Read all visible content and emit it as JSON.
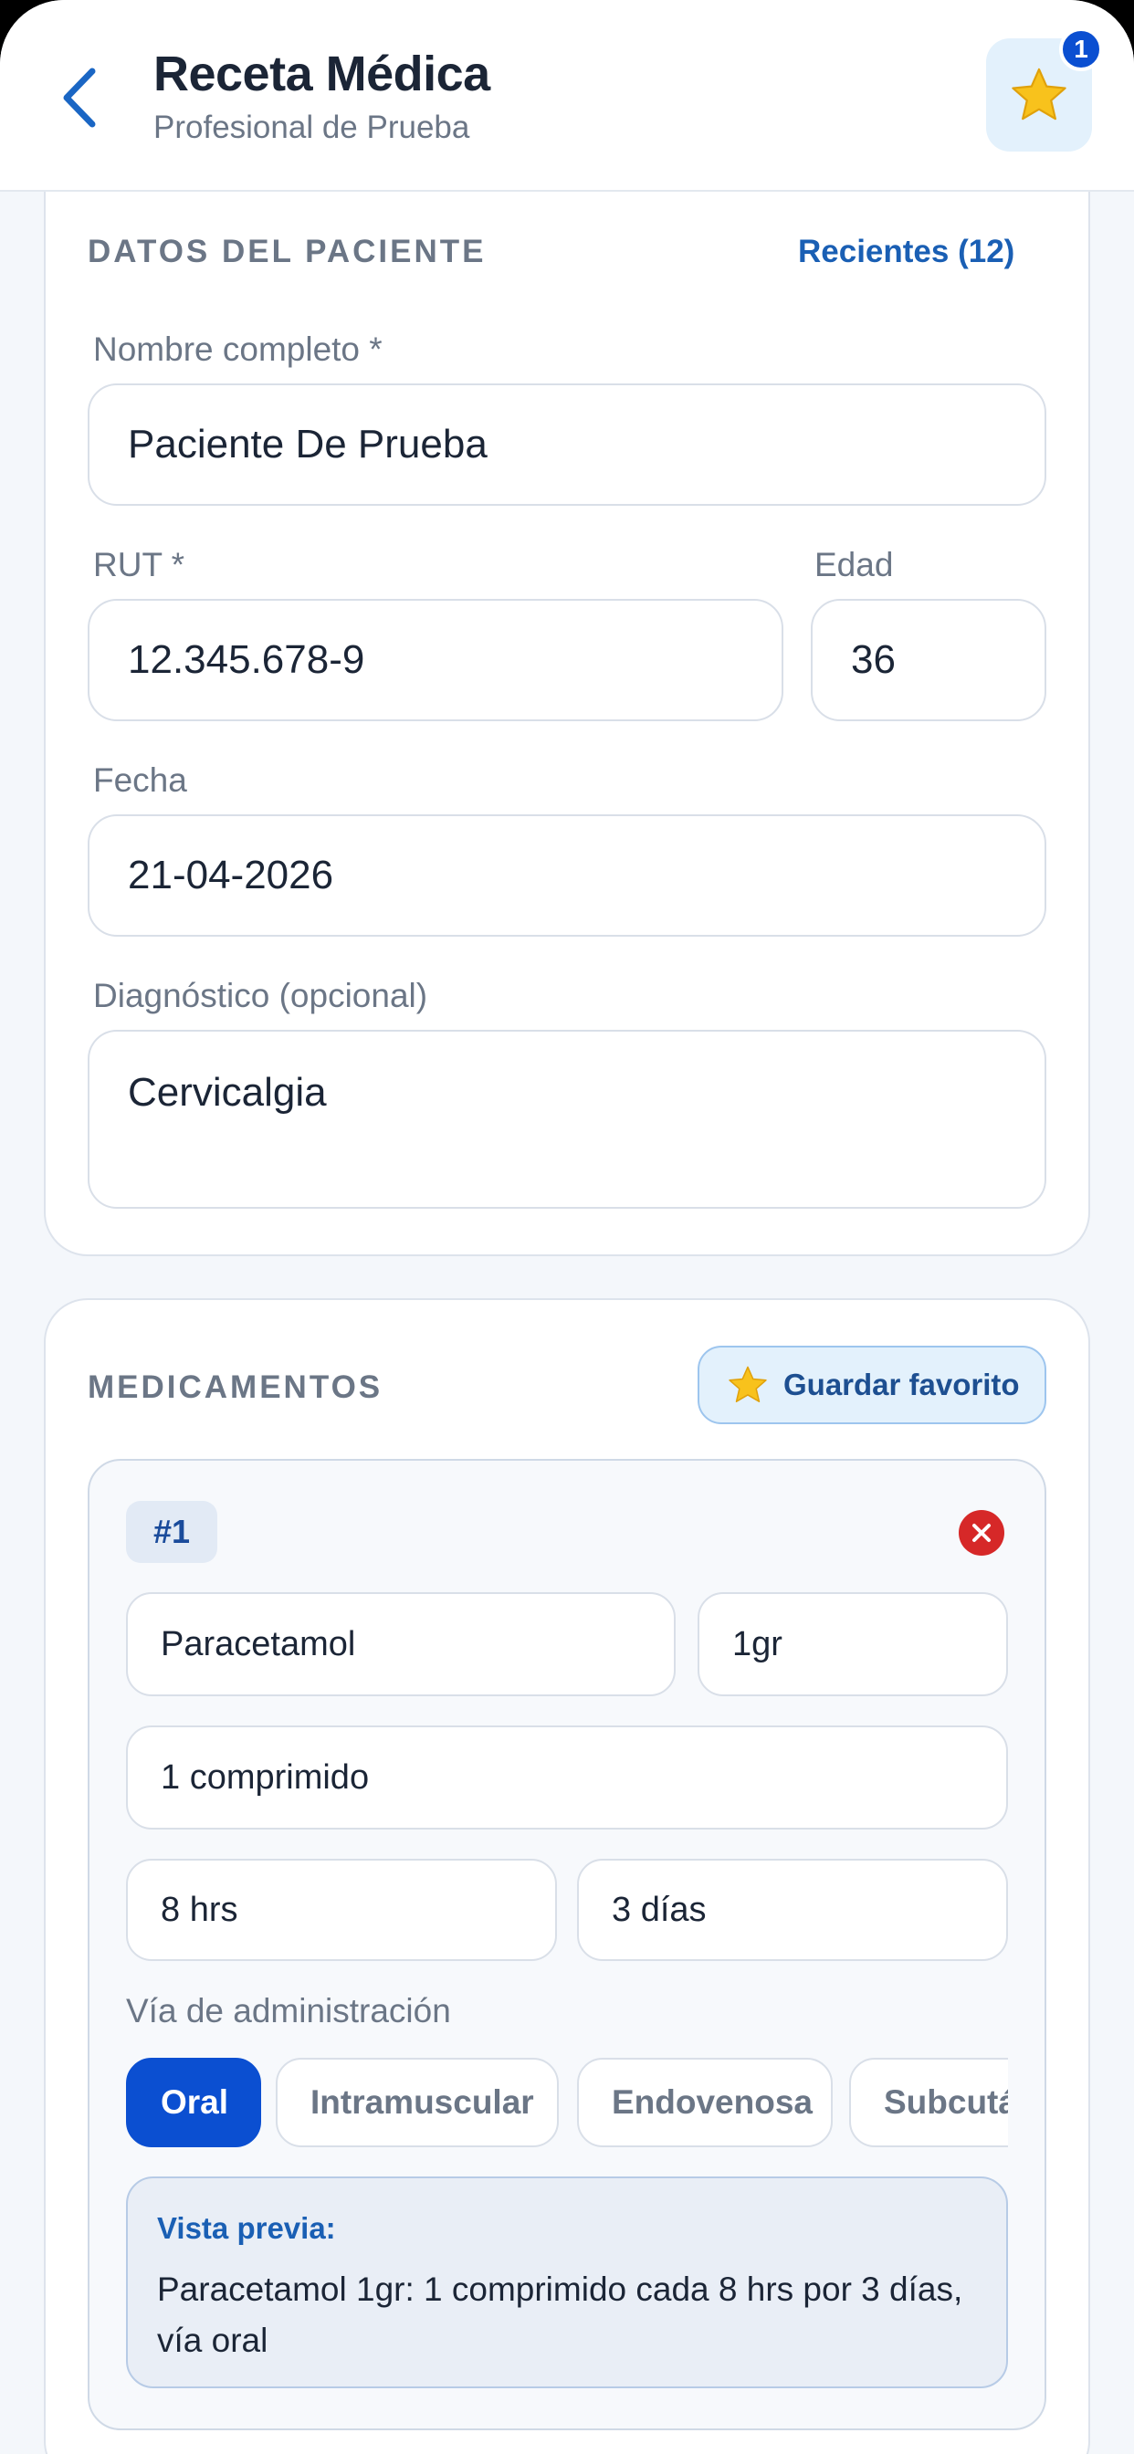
{
  "header": {
    "title": "Receta Médica",
    "subtitle": "Profesional de Prueba",
    "favorites_count": "1"
  },
  "patient": {
    "section_title": "DATOS DEL PACIENTE",
    "recent_link": "Recientes (12)",
    "name_label": "Nombre completo *",
    "name_value": "Paciente De Prueba",
    "rut_label": "RUT *",
    "rut_value": "12.345.678-9",
    "age_label": "Edad",
    "age_value": "36",
    "date_label": "Fecha",
    "date_value": "21-04-2026",
    "diagnosis_label": "Diagnóstico (opcional)",
    "diagnosis_value": "Cervicalgia"
  },
  "medications": {
    "section_title": "MEDICAMENTOS",
    "save_favorite_label": "Guardar favorito",
    "items": [
      {
        "number": "#1",
        "name": "Paracetamol",
        "dose": "1gr",
        "quantity": "1 comprimido",
        "frequency": "8 hrs",
        "duration": "3 días",
        "route_label": "Vía de administración",
        "routes": [
          "Oral",
          "Intramuscular",
          "Endovenosa",
          "Subcutá"
        ],
        "selected_route": "Oral",
        "preview_title": "Vista previa:",
        "preview_text": "Paracetamol 1gr: 1 comprimido cada 8 hrs por 3 días, vía oral"
      }
    ]
  },
  "colors": {
    "accent": "#0b4fd1",
    "link": "#1a5fb4",
    "danger": "#d62828",
    "background": "#f4f7fb"
  },
  "icons": {
    "back": "chevron-left-icon",
    "favorites": "star-icon",
    "remove": "close-icon"
  }
}
